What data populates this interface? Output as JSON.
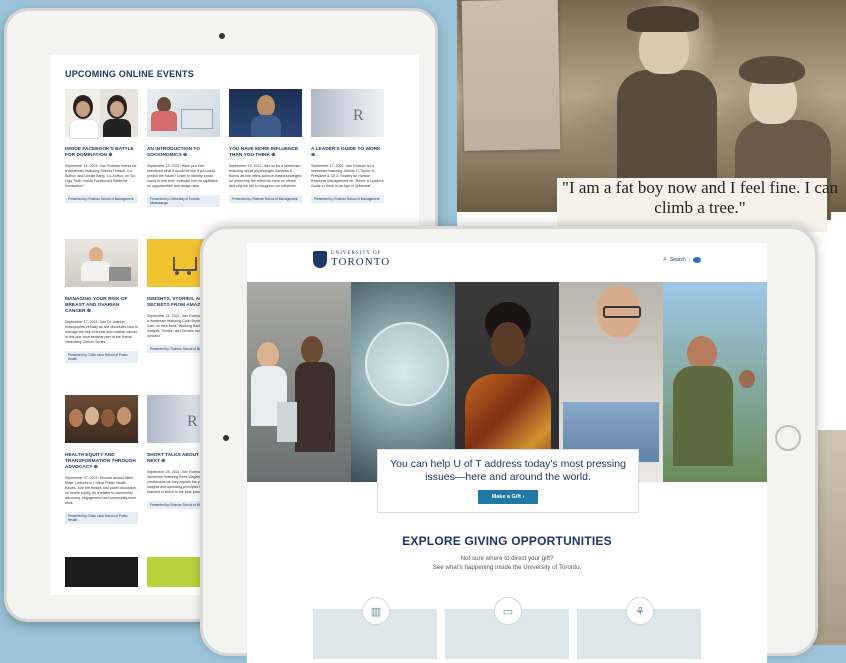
{
  "back_tablet": {
    "section_title": "UPCOMING ONLINE EVENTS",
    "events": [
      {
        "title": "INSIDE FACEBOOK'S BATTLE FOR DOMINATION ⊕",
        "body": "September 14, 2021: Join Rotman events for a livestream featuring Sheera Frenkel, Co-Author, and Cecilia Kang, Co-Author, on \"An Ugly Truth: Inside Facebook's Battle for Domination\".",
        "org": "Presented by: Rotman School of Management"
      },
      {
        "title": "AN INTRODUCTION TO SOCIONOMICS ⊕",
        "body": "September 14, 2021: Have you ever wondered what it would be like if you could predict the future? Learn to identify social mood in real time, evaluate how to capitalize on opportunities and dodge risks.",
        "org": "Presented by: University of Toronto Mississauga"
      },
      {
        "title": "YOU HAVE MORE INFLUENCE THAN YOU THINK ⊕",
        "body": "September 15, 2021: Join us for a livestream featuring social psychologist Vanessa K. Bohns as she offers science-based strategies for observing the effect we have on others and why we fail to recognize our influence.",
        "org": "Presented by: Rotman School of Management"
      },
      {
        "title": "A LEADER'S GUIDE TO WORK ⊕",
        "body": "September 17, 2021: Join Rotman for a livestream featuring Johnny C. Taylor Jr., President & CEO, Society for Human Resource Management on \"Reset: A Leader's Guide to Work in an Age of Upheaval\".",
        "org": "Presented by: Rotman School of Management"
      },
      {
        "title": "MANAGING YOUR RISK OF BREAST AND OVARIAN CANCER ⊕",
        "body": "September 17, 2021: Join Dr. Joanne Kotsopoulos virtually as she discusses how to manage the risk of breast and ovarian cancer, in this one-hour seminar part of the Virtual Hereditary Cancer Series.",
        "org": "Presented by: Dalla Lana School of Public Health"
      },
      {
        "title": "INSIGHTS, STORIES, AND SECRETS FROM AMAZON ⊕",
        "body": "September 21, 2021: Join Rotman Events for a livestream featuring Colin Bryar, and Bill Carr, on their book \"Working Backwards: Insights, Stories, and Secrets from Inside Amazon\".",
        "org": "Presented by: Rotman School of Management"
      },
      {
        "title": "HEALTH EQUITY AND TRANSFORMATION THROUGH ADVOCACY ⊕",
        "body": "September 27, 2021: Second annual Allies Miller Lectures in Critical Public Health Issues. Join the lecture and panel discussion on health equity, as it relates to community advocacy, engagement and community-level work.",
        "org": "Presented by: Dalla Lana School of Public Health"
      },
      {
        "title": "SHORT TALKS ABOUT WHAT'S NEXT ⊕",
        "body": "September 28, 2021: Join Rotman for a livestream featuring three Magazine contributors as they explain the emotions, insights and operating principles that will be required to thrive in the post-pandemic world.",
        "org": "Presented by: Rotman School of Management"
      }
    ]
  },
  "quote": "\"I am a fat boy now and I feel fine. I can climb a tree.\"",
  "front_tablet": {
    "logo_small": "UNIVERSITY OF",
    "logo_big": "TORONTO",
    "search_label": "Search",
    "hero_text": "You can help U of T address today's most pressing issues—here and around the world.",
    "gift_button": "Make a Gift ›",
    "explore_title": "EXPLORE GIVING OPPORTUNITIES",
    "explore_sub_1": "Not sure where to direct your gift?",
    "explore_sub_2": "See what's happening inside the University of Toronto.",
    "opportunity_icons": [
      "building-icon",
      "book-icon",
      "sprout-icon"
    ]
  },
  "colors": {
    "uoft_navy": "#1e3765",
    "gift_button": "#1e7aa3",
    "background": "#9cc3d9"
  }
}
